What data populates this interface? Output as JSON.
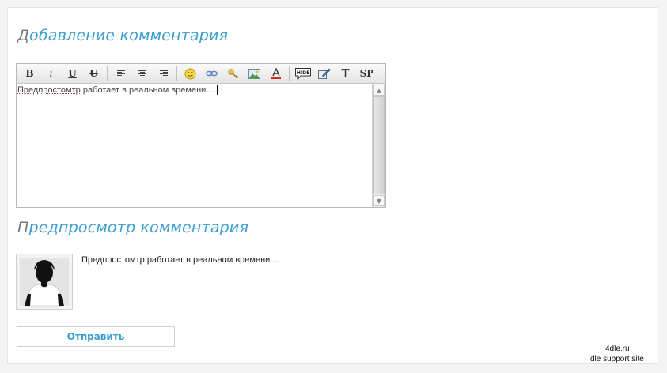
{
  "add_comment": {
    "heading_first": "Д",
    "heading_rest": "обавление комментария"
  },
  "toolbar": {
    "bold": "B",
    "italic": "i",
    "underline": "U",
    "strike": "U",
    "text_format": "T",
    "spoiler": "SP",
    "hide_label": "HIDE"
  },
  "editor": {
    "text_misspelled": "Предпростомтр",
    "text_rest": " работает в реальном времени....",
    "scroll_up": "▲",
    "scroll_down": "▼"
  },
  "preview": {
    "heading_first": "П",
    "heading_rest": "редпросмотр комментария",
    "text": "Предпростомтр работает в реальном времени...."
  },
  "submit_label": "Отправить",
  "watermark": {
    "line1": "4dle.ru",
    "line2": "dle support site"
  },
  "colors": {
    "accent": "#3a9fd0",
    "heading_initial": "#777777"
  }
}
